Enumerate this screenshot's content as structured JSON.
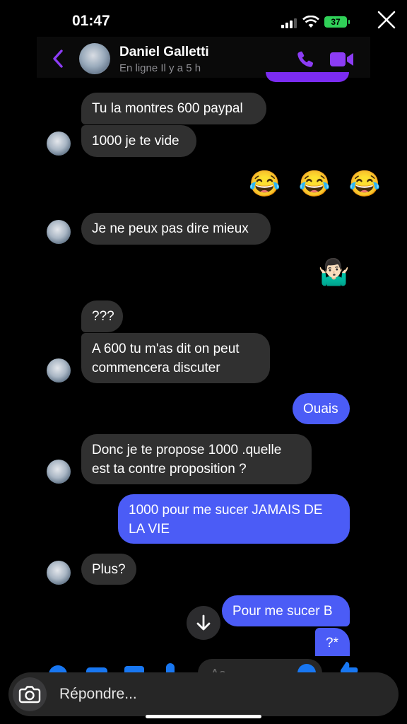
{
  "status_bar": {
    "time": "01:47",
    "battery": "37"
  },
  "header": {
    "name": "Daniel Galletti",
    "status": "En ligne Il y a 5 h"
  },
  "messages": [
    {
      "text": "Tu la montres 600 paypal"
    },
    {
      "text": "1000 je te vide"
    },
    {
      "text": "😂 😂 😂"
    },
    {
      "text": "Je ne peux pas dire mieux"
    },
    {
      "text": "🤷🏻‍♂️"
    },
    {
      "text": "???"
    },
    {
      "line1": "A 600 tu m'as dit on peut",
      "line2": "commencera discuter"
    },
    {
      "text": "Ouais"
    },
    {
      "line1": "Donc je te propose 1000 .quelle",
      "line2": "est ta contre proposition ?"
    },
    {
      "line1": "1000 pour me sucer JAMAIS DE",
      "line2": "LA VIE"
    },
    {
      "text": "Plus?"
    },
    {
      "text": "Pour me sucer B"
    },
    {
      "text": "?*"
    }
  ],
  "composer": {
    "placeholder": "Aa"
  },
  "reply": {
    "placeholder": "Répondre..."
  },
  "colors": {
    "accent": "#7b2cf1",
    "outgoing_bubble": "#4b5cf6",
    "incoming_bubble": "#303030"
  },
  "icons": [
    "close-icon",
    "back-chevron-icon",
    "phone-icon",
    "video-icon",
    "arrow-down-icon",
    "plus-icon",
    "camera-icon",
    "gallery-icon",
    "mic-icon",
    "emoji-icon",
    "thumbs-up-icon"
  ]
}
